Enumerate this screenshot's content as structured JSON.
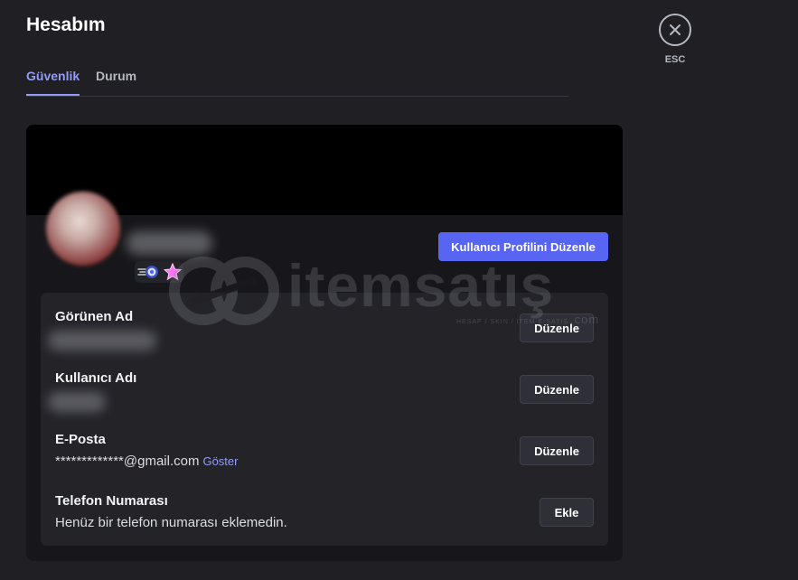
{
  "header": {
    "title": "Hesabım",
    "close": {
      "icon": "close-icon",
      "label": "ESC"
    }
  },
  "tabs": [
    {
      "label": "Güvenlik",
      "active": true
    },
    {
      "label": "Durum",
      "active": false
    }
  ],
  "profile": {
    "edit_profile_label": "Kullanıcı Profilini Düzenle",
    "badges": [
      "boost-badge-icon",
      "nitro-badge-icon"
    ],
    "accent_color": "#5865f2"
  },
  "fields": {
    "display_name": {
      "label": "Görünen Ad",
      "button": "Düzenle"
    },
    "username": {
      "label": "Kullanıcı Adı",
      "button": "Düzenle"
    },
    "email": {
      "label": "E-Posta",
      "value": "*************@gmail.com",
      "reveal": "Göster",
      "button": "Düzenle"
    },
    "phone": {
      "label": "Telefon Numarası",
      "value": "Henüz bir telefon numarası eklemedin.",
      "button": "Ekle"
    }
  },
  "watermark": {
    "brand": "itemsatış",
    "tagline": "HESAP / SKIN / ITEM E-SATIŞ",
    "tld": ".com"
  }
}
